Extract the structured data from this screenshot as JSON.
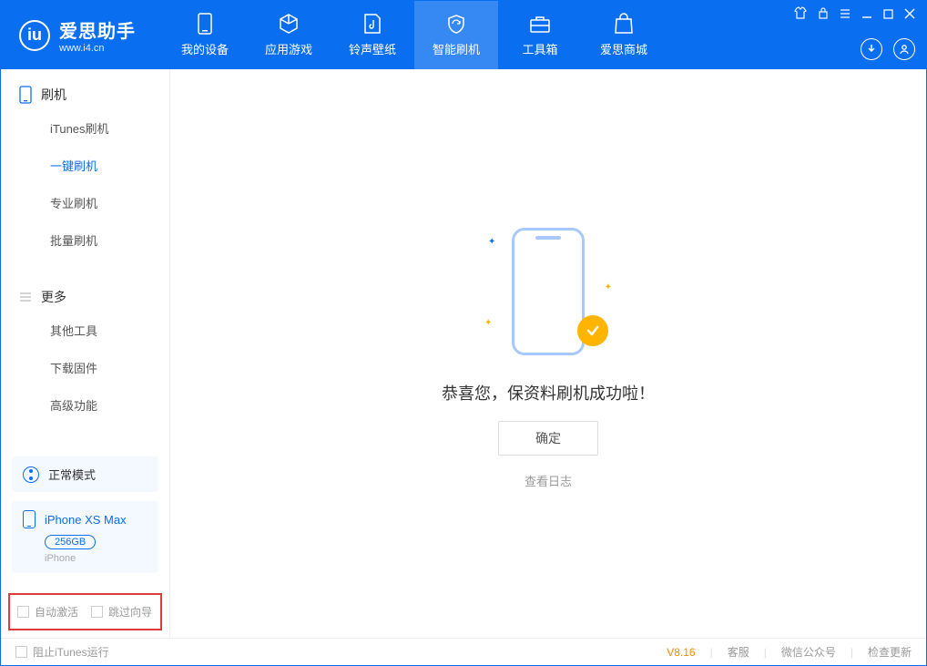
{
  "app": {
    "title": "爱思助手",
    "subtitle": "www.i4.cn"
  },
  "nav": {
    "tabs": [
      {
        "label": "我的设备"
      },
      {
        "label": "应用游戏"
      },
      {
        "label": "铃声壁纸"
      },
      {
        "label": "智能刷机"
      },
      {
        "label": "工具箱"
      },
      {
        "label": "爱思商城"
      }
    ]
  },
  "sidebar": {
    "section1": {
      "title": "刷机",
      "items": [
        "iTunes刷机",
        "一键刷机",
        "专业刷机",
        "批量刷机"
      ]
    },
    "section2": {
      "title": "更多",
      "items": [
        "其他工具",
        "下载固件",
        "高级功能"
      ]
    }
  },
  "device": {
    "mode": "正常模式",
    "name": "iPhone XS Max",
    "capacity": "256GB",
    "type": "iPhone"
  },
  "options": {
    "auto_activate": "自动激活",
    "skip_guide": "跳过向导"
  },
  "main": {
    "success_text": "恭喜您，保资料刷机成功啦！",
    "ok_button": "确定",
    "view_log": "查看日志"
  },
  "footer": {
    "block_itunes": "阻止iTunes运行",
    "version": "V8.16",
    "links": [
      "客服",
      "微信公众号",
      "检查更新"
    ]
  }
}
